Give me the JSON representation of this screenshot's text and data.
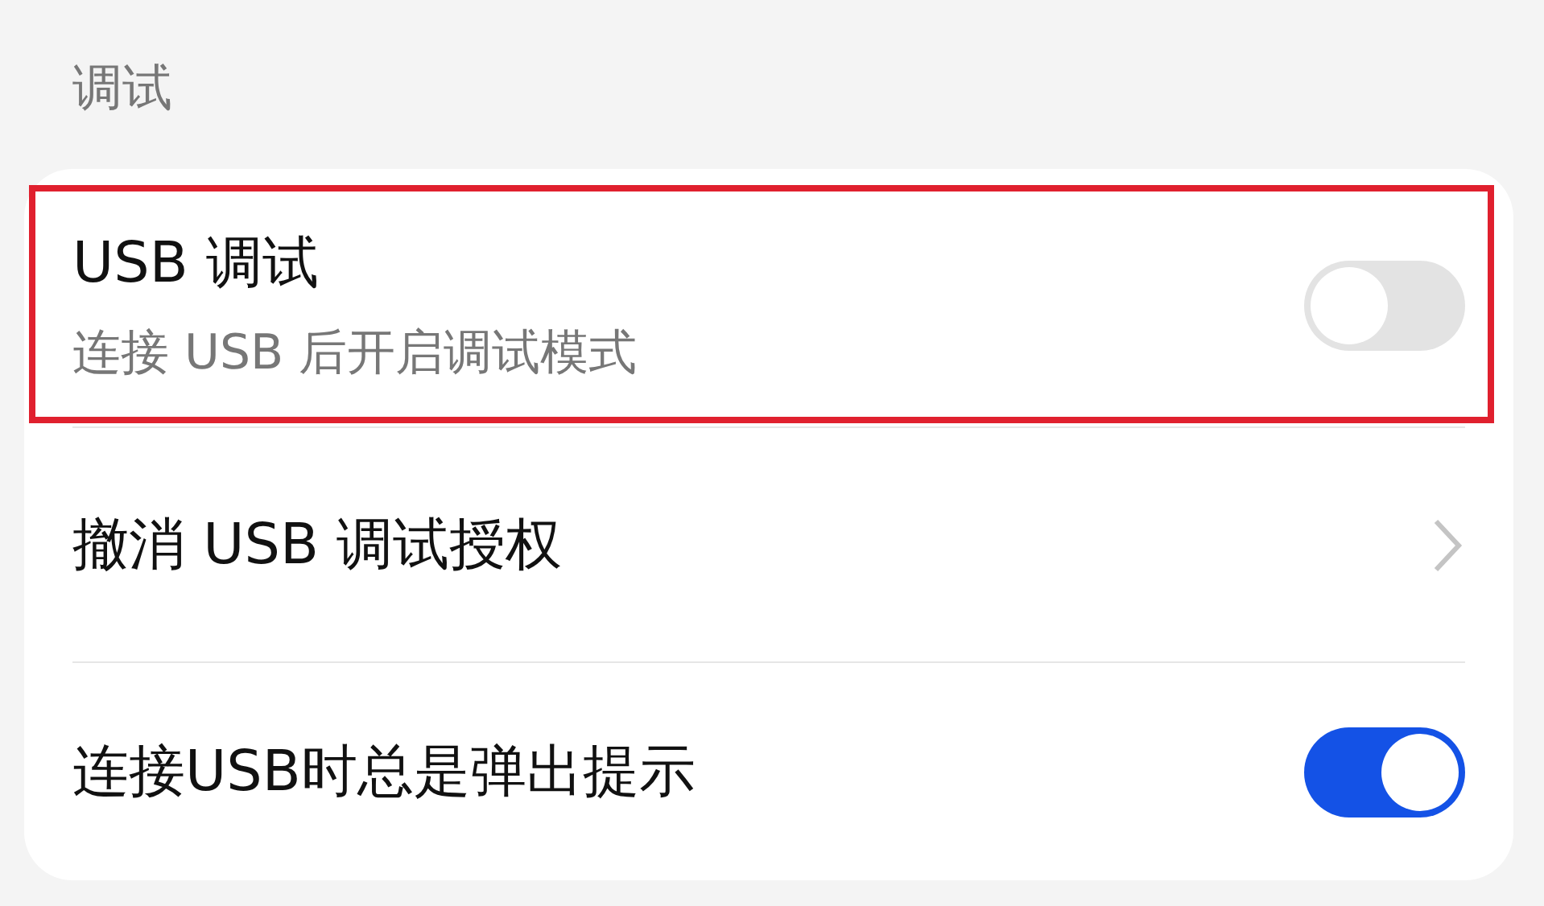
{
  "section_title": "调试",
  "items": [
    {
      "kind": "toggle",
      "title": "USB 调试",
      "subtitle": "连接 USB 后开启调试模式",
      "on": false,
      "highlighted": true
    },
    {
      "kind": "link",
      "title": "撤消 USB 调试授权",
      "highlighted": false
    },
    {
      "kind": "toggle",
      "title": "连接USB时总是弹出提示",
      "on": true,
      "highlighted": false
    }
  ]
}
